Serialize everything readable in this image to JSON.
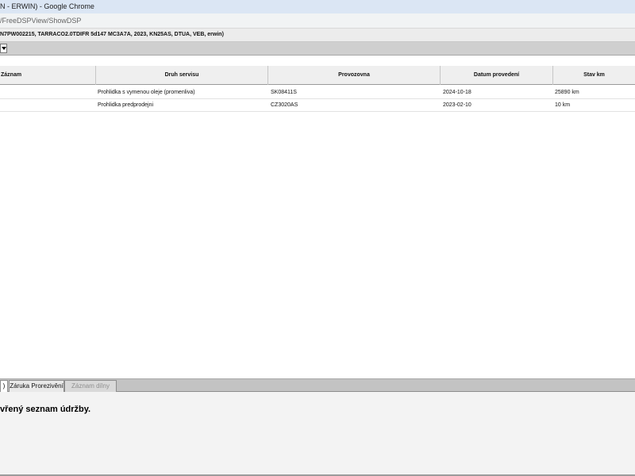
{
  "window": {
    "title": "N - ERWIN) - Google Chrome",
    "url": "/FreeDSPView/ShowDSP"
  },
  "vehicle": {
    "info": "N7PW002215, TARRACO2.0TDIFR 5d147 MC3A7A, 2023, KN25AS, DTUA, VEB, erwin)"
  },
  "table": {
    "columns": [
      "Záznam",
      "Druh servisu",
      "Provozovna",
      "Datum provedení",
      "Stav km"
    ],
    "rows": [
      {
        "zaznam": "",
        "druh": "Prohlidka s vymenou oleje (promenliva)",
        "provozovna": "SK08411S",
        "datum": "2024-10-18",
        "km": "25890 km"
      },
      {
        "zaznam": "",
        "druh": "Prohlidka predprodejni",
        "provozovna": "CZ3020AS",
        "datum": "2023-02-10",
        "km": "10 km"
      }
    ]
  },
  "tabs": [
    {
      "label": ")"
    },
    {
      "label": "Záruka Prorezivění"
    },
    {
      "label": "Záznam dílny"
    }
  ],
  "panel": {
    "message": "vřený seznam údržby."
  }
}
